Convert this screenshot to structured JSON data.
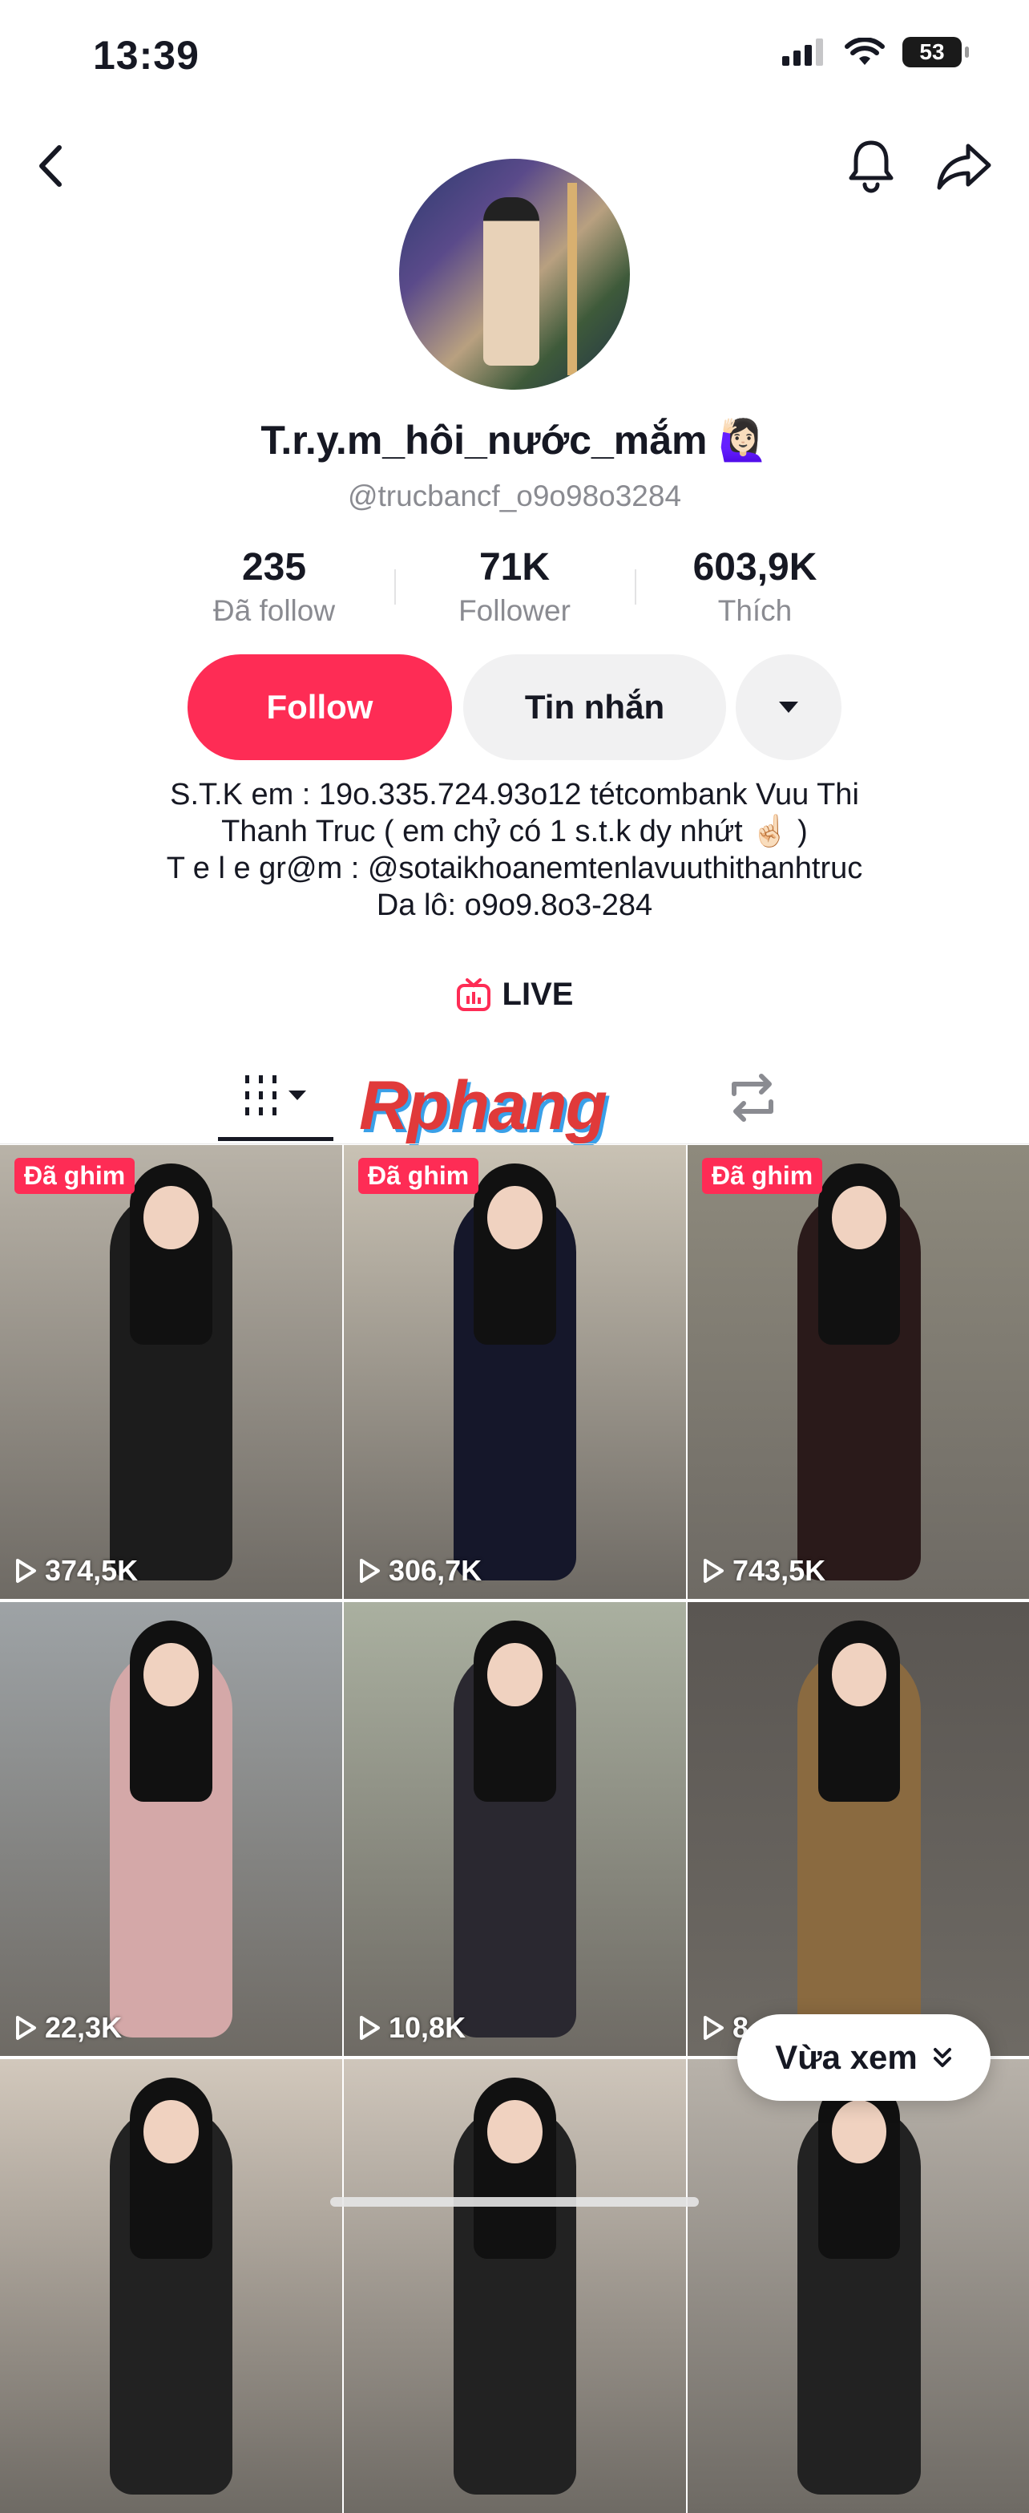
{
  "status_bar": {
    "time": "13:39",
    "battery": "53"
  },
  "profile": {
    "display_name": "T.r.y.m_hôi_nước_mắm 🙋🏻‍♀️",
    "handle": "@trucbancf_o9o98o3284",
    "stats": [
      {
        "value": "235",
        "label": "Đã follow"
      },
      {
        "value": "71K",
        "label": "Follower"
      },
      {
        "value": "603,9K",
        "label": "Thích"
      }
    ]
  },
  "actions": {
    "follow": "Follow",
    "message": "Tin nhắn"
  },
  "bio": [
    "S.T.K em : 19o.335.724.93o12 tétcombank Vuu Thi",
    "Thanh Truc ( em chỷ có 1 s.t.k dy nhứt ☝🏻 )",
    "T e l e gr@m : @sotaikhoanemtenlavuuthithanhtruc",
    "Da lô: o9o9.8o3-284"
  ],
  "live_label": "LIVE",
  "watermark": "Rphang",
  "videos": [
    {
      "pinned": "Đã ghim",
      "views": "374,5K",
      "bg": "#b9b3a8",
      "outfit": "#1c1c1c"
    },
    {
      "pinned": "Đã ghim",
      "views": "306,7K",
      "bg": "#c9c2b4",
      "outfit": "#15172a"
    },
    {
      "pinned": "Đã ghim",
      "views": "743,5K",
      "bg": "#8e8a7d",
      "outfit": "#2a1a1a"
    },
    {
      "pinned": "",
      "views": "22,3K",
      "bg": "#9ea3a6",
      "outfit": "#d4a8a8"
    },
    {
      "pinned": "",
      "views": "10,8K",
      "bg": "#aab0a0",
      "outfit": "#2a2830"
    },
    {
      "pinned": "",
      "views": "8",
      "bg": "#5a5652",
      "outfit": "#8a6a40"
    },
    {
      "pinned": "",
      "views": "",
      "bg": "#d2c8bc",
      "outfit": "#222"
    },
    {
      "pinned": "",
      "views": "",
      "bg": "#cfc6bb",
      "outfit": "#222"
    },
    {
      "pinned": "",
      "views": "",
      "bg": "#b8b2aa",
      "outfit": "#222"
    }
  ],
  "recent_button": "Vừa xem",
  "colors": {
    "accent": "#fe2c55",
    "muted": "#8a8b91"
  }
}
